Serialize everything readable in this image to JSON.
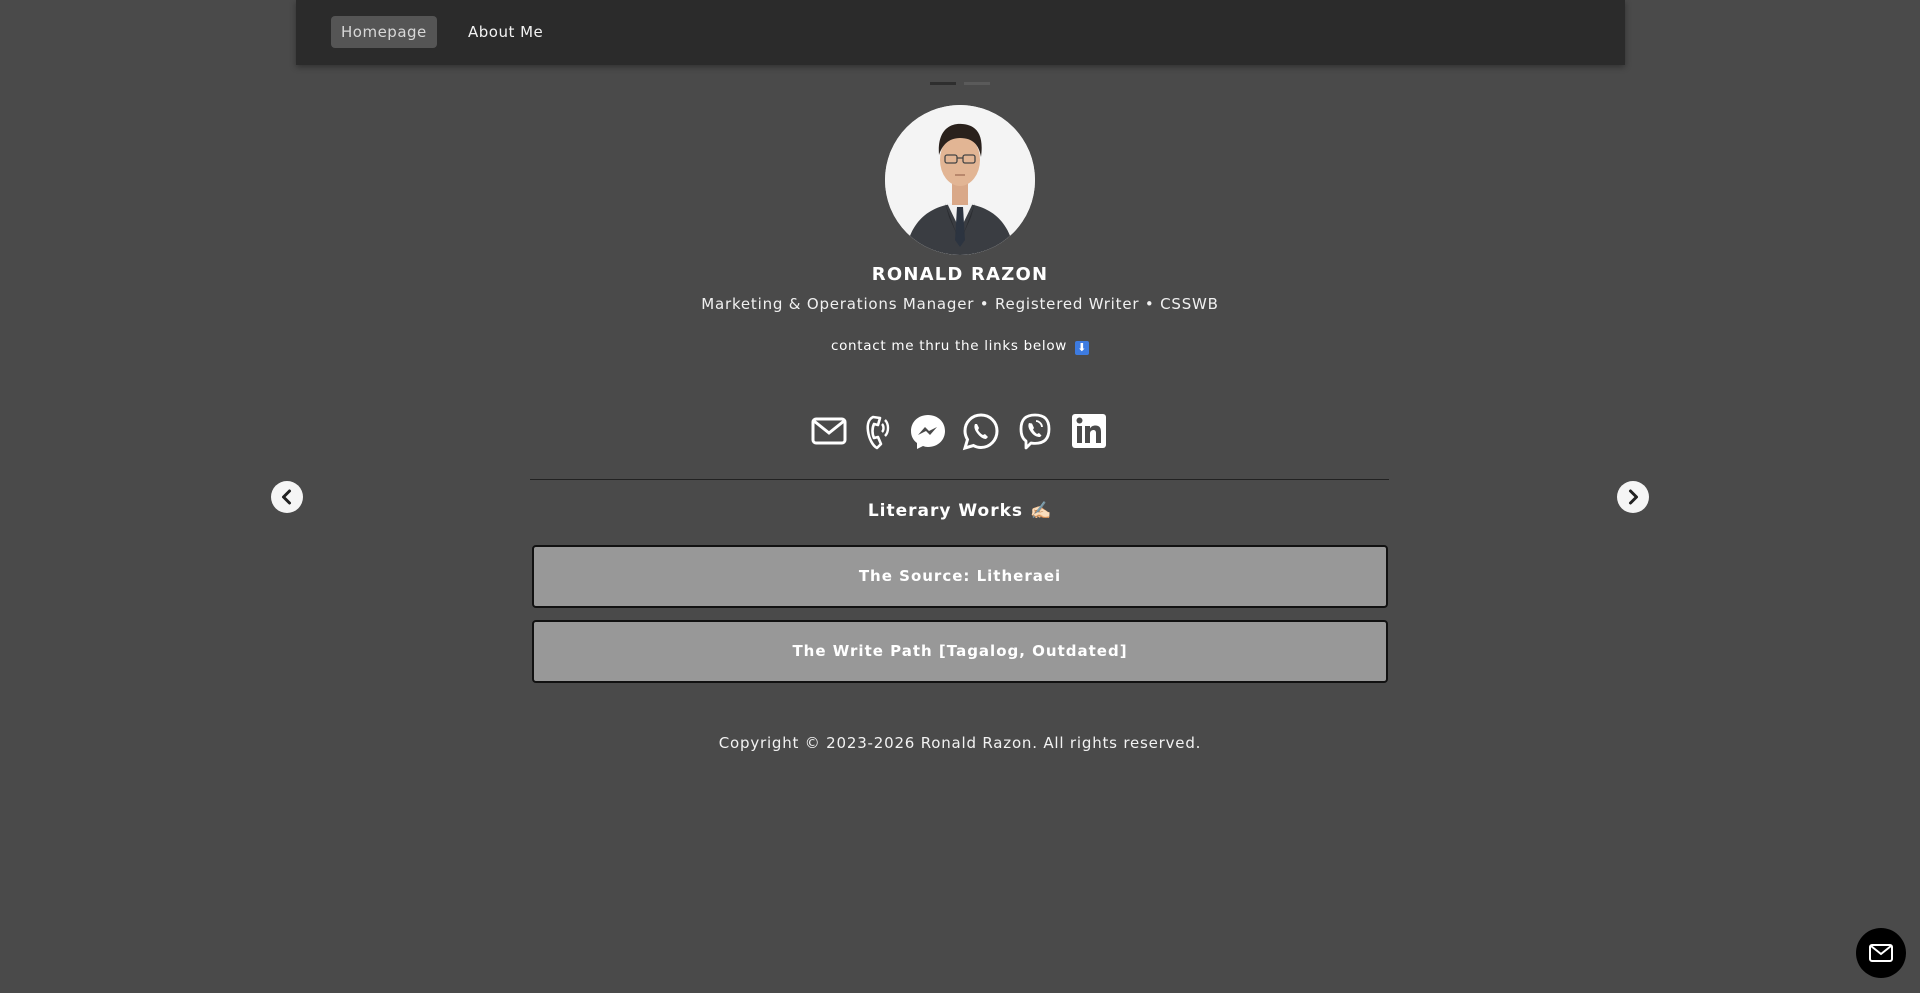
{
  "nav": {
    "items": [
      {
        "label": "Homepage",
        "active": true
      },
      {
        "label": "About Me",
        "active": false
      }
    ]
  },
  "profile": {
    "name": "RONALD RAZON",
    "subtitle": "Marketing & Operations Manager • Registered Writer • CSSWB",
    "contact_note": "contact me thru the links below",
    "contact_note_icon": "⬇"
  },
  "social_links": [
    "email-icon",
    "phone-icon",
    "messenger-icon",
    "whatsapp-icon",
    "viber-icon",
    "linkedin-icon"
  ],
  "works": {
    "title": "Literary Works",
    "title_icon": "✍🏻",
    "items": [
      {
        "label": "The Source: Litheraei"
      },
      {
        "label": "The Write Path [Tagalog, Outdated]"
      }
    ]
  },
  "footer": {
    "copyright": "Copyright © 2023-2026 Ronald Razon. All rights reserved."
  },
  "colors": {
    "background": "#4a4a4a",
    "navbar": "#2b2b2b",
    "button": "#989898",
    "text": "#ffffff"
  }
}
